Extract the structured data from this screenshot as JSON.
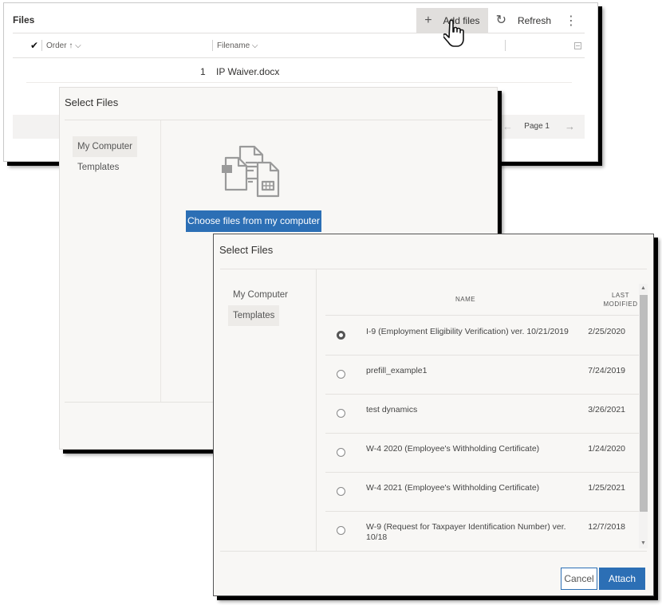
{
  "files_panel": {
    "title": "Files",
    "commands": {
      "add_files": {
        "icon": "plus-icon",
        "glyph": "+",
        "label": "Add files"
      },
      "refresh": {
        "icon": "refresh-icon",
        "glyph": "↻",
        "label": "Refresh"
      },
      "more": {
        "icon": "more-vertical-icon",
        "glyph": "⋮"
      }
    },
    "columns": {
      "check_glyph": "✔",
      "order": "Order ↑ ⌵",
      "filename": "Filename ⌵"
    },
    "rows": [
      {
        "order": "1",
        "filename": "IP Waiver.docx"
      }
    ],
    "pager": {
      "prev_glyph": "←",
      "label": "Page 1",
      "next_glyph": "→"
    }
  },
  "dialog_my_computer": {
    "title": "Select Files",
    "nav": [
      {
        "label": "My Computer",
        "active": true
      },
      {
        "label": "Templates",
        "active": false
      }
    ],
    "choose_button": "Choose files from my computer"
  },
  "dialog_templates": {
    "title": "Select Files",
    "nav": [
      {
        "label": "My Computer",
        "active": false
      },
      {
        "label": "Templates",
        "active": true
      }
    ],
    "table": {
      "headers": {
        "name": "NAME",
        "last_modified_1": "LAST",
        "last_modified_2": "MODIFIED"
      },
      "rows": [
        {
          "name": "I-9 (Employment Eligibility Verification) ver. 10/21/2019",
          "modified": "2/25/2020",
          "selected": true
        },
        {
          "name": "prefill_example1",
          "modified": "7/24/2019",
          "selected": false
        },
        {
          "name": "test dynamics",
          "modified": "3/26/2021",
          "selected": false
        },
        {
          "name": "W-4 2020 (Employee's Withholding Certificate)",
          "modified": "1/24/2020",
          "selected": false
        },
        {
          "name": "W-4 2021 (Employee's Withholding Certificate)",
          "modified": "1/25/2021",
          "selected": false
        },
        {
          "name": "W-9 (Request for Taxpayer Identification Number) ver. 10/18",
          "modified": "12/7/2018",
          "selected": false
        }
      ]
    },
    "scroll": {
      "up_glyph": "▲",
      "down_glyph": "▼"
    },
    "buttons": {
      "cancel": "Cancel",
      "attach": "Attach"
    }
  },
  "colors": {
    "primary": "#2c6fb5",
    "dialog_bg": "#f8f7f5",
    "hover_bg": "#e1dfdd"
  }
}
